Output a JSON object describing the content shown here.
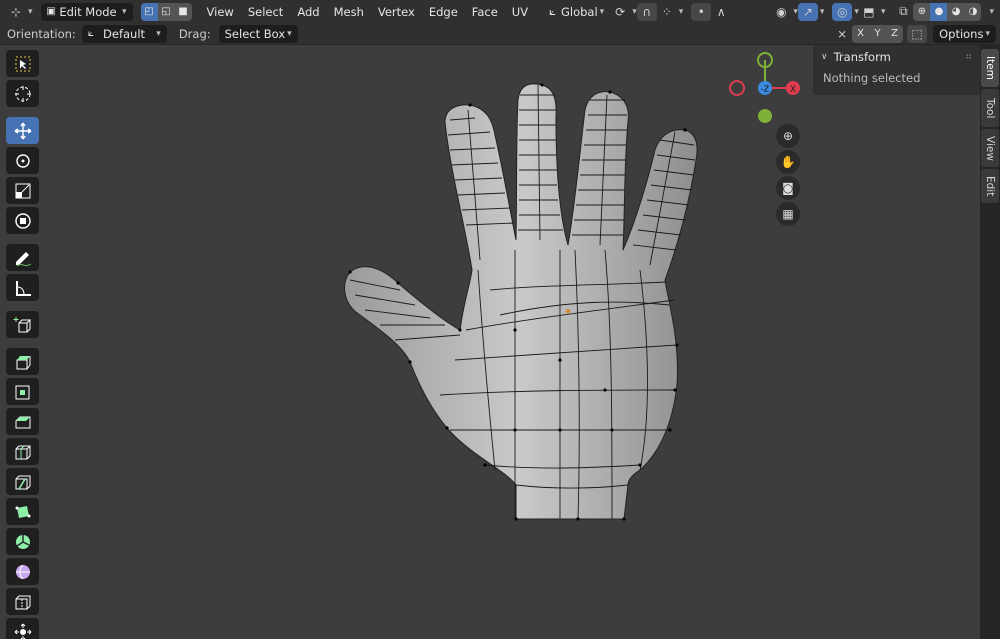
{
  "header": {
    "mode": "Edit Mode",
    "menus": [
      "View",
      "Select",
      "Add",
      "Mesh",
      "Vertex",
      "Edge",
      "Face",
      "UV"
    ],
    "transform_orientation": "Global",
    "axes": [
      "X",
      "Y",
      "Z"
    ],
    "options": "Options"
  },
  "subheader": {
    "orientation_label": "Orientation:",
    "orientation_value": "Default",
    "drag_label": "Drag:",
    "drag_value": "Select Box"
  },
  "gizmo": {
    "x_label": "X",
    "z_label": "-Z",
    "colors": {
      "x": "#e03c4f",
      "y": "#7fb03a",
      "z": "#3c8ae0"
    }
  },
  "sidebar": {
    "panel_title": "Transform",
    "status": "Nothing selected",
    "tabs": [
      "Item",
      "Tool",
      "View",
      "Edit"
    ]
  },
  "colors": {
    "accent": "#4772b3",
    "background": "#3d3d3d",
    "header": "#303030"
  },
  "tools": [
    "select-box",
    "cursor",
    "move",
    "rotate",
    "scale",
    "transform",
    "annotate",
    "measure",
    "add-cube",
    "extrude-region",
    "inset-faces",
    "bevel",
    "loop-cut",
    "knife",
    "poly-build",
    "spin",
    "smooth",
    "edge-slide",
    "shrink-fatten"
  ]
}
